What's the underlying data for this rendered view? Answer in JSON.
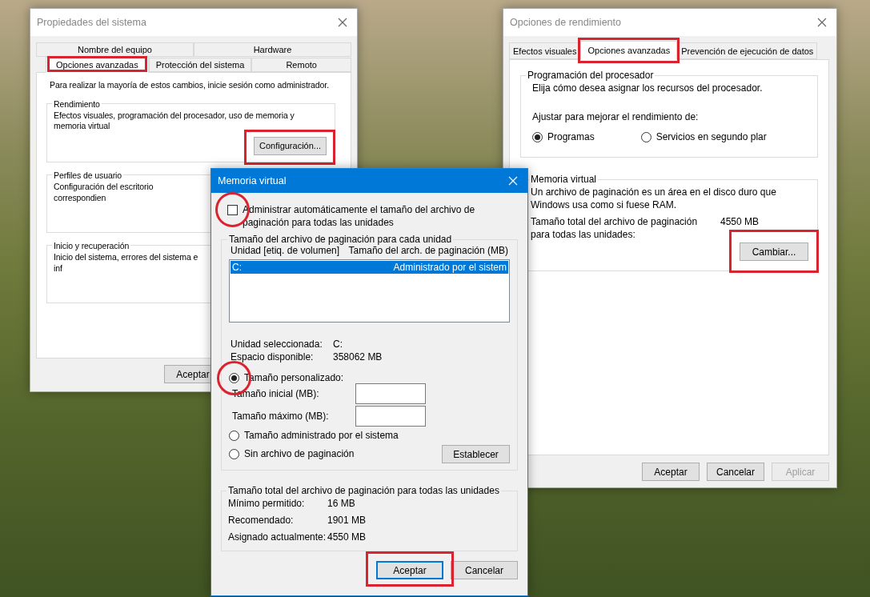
{
  "system_properties": {
    "title": "Propiedades del sistema",
    "tab_rows": [
      [
        {
          "label": "Nombre del equipo",
          "selected": false
        },
        {
          "label": "Hardware",
          "selected": false
        }
      ],
      [
        {
          "label": "Opciones avanzadas",
          "selected": true,
          "highlighted": true
        },
        {
          "label": "Protección del sistema",
          "selected": false
        },
        {
          "label": "Remoto",
          "selected": false
        }
      ]
    ],
    "notice": "Para realizar la mayoría de estos cambios, inicie sesión como administrador.",
    "groups": [
      {
        "title": "Rendimiento",
        "text": "Efectos visuales, programación del procesador, uso de memoria y memoria virtual",
        "button": {
          "label": "Configuración...",
          "highlighted": true
        }
      },
      {
        "title": "Perfiles de usuario",
        "text": "Configuración del escritorio correspondien"
      },
      {
        "title": "Inicio y recuperación",
        "text": "Inicio del sistema, errores del sistema e inf"
      }
    ],
    "buttons": [
      {
        "label": "Aceptar",
        "disabled": false
      }
    ]
  },
  "performance_options": {
    "title": "Opciones de rendimiento",
    "tabs": [
      {
        "label": "Efectos visuales",
        "selected": false
      },
      {
        "label": "Opciones avanzadas",
        "selected": true,
        "highlighted": true
      },
      {
        "label": "Prevención de ejecución de datos",
        "selected": false
      }
    ],
    "processor_group": {
      "title": "Programación del procesador",
      "text": "Elija cómo desea asignar los recursos del procesador.",
      "adjust_label": "Ajustar para mejorar el rendimiento de:",
      "options": [
        {
          "label": "Programas",
          "selected": true
        },
        {
          "label": "Servicios en segundo plar",
          "selected": false
        }
      ]
    },
    "memory_group": {
      "title": "Memoria virtual",
      "text": "Un archivo de paginación es un área en el disco duro que Windows usa como si fuese RAM.",
      "total_label": "Tamaño total del archivo de paginación para todas las unidades:",
      "total_value": "4550 MB",
      "button": {
        "label": "Cambiar...",
        "highlighted": true
      }
    },
    "buttons": [
      {
        "label": "Aceptar",
        "disabled": false
      },
      {
        "label": "Cancelar",
        "disabled": false
      },
      {
        "label": "Aplicar",
        "disabled": true
      }
    ]
  },
  "virtual_memory": {
    "title": "Memoria virtual",
    "auto_manage": {
      "label": "Administrar automáticamente el tamaño del archivo de paginación para todas las unidades",
      "checked": false,
      "highlighted": true
    },
    "drives_group": {
      "title": "Tamaño del archivo de paginación para cada unidad",
      "columns": [
        "Unidad [etiq. de volumen]",
        "Tamaño del arch. de paginación (MB)"
      ],
      "rows": [
        {
          "drive": "C:",
          "size": "Administrado por el sistem",
          "selected": true
        }
      ],
      "info": [
        {
          "label": "Unidad seleccionada:",
          "value": "C:"
        },
        {
          "label": "Espacio disponible:",
          "value": "358062 MB"
        }
      ],
      "options": [
        {
          "label": "Tamaño personalizado:",
          "selected": true,
          "highlighted": true
        },
        {
          "label": "Tamaño administrado por el sistema",
          "selected": false
        },
        {
          "label": "Sin archivo de paginación",
          "selected": false
        }
      ],
      "fields": [
        {
          "label": "Tamaño inicial (MB):"
        },
        {
          "label": "Tamaño máximo (MB):"
        }
      ],
      "set_button": "Establecer"
    },
    "totals_group": {
      "title": "Tamaño total del archivo de paginación para todas las unidades",
      "rows": [
        {
          "label": "Mínimo permitido:",
          "value": "16 MB"
        },
        {
          "label": "Recomendado:",
          "value": "1901 MB"
        },
        {
          "label": "Asignado actualmente:",
          "value": "4550 MB"
        }
      ]
    },
    "buttons": [
      {
        "label": "Aceptar",
        "default": true,
        "highlighted": true
      },
      {
        "label": "Cancelar",
        "default": false
      }
    ]
  }
}
